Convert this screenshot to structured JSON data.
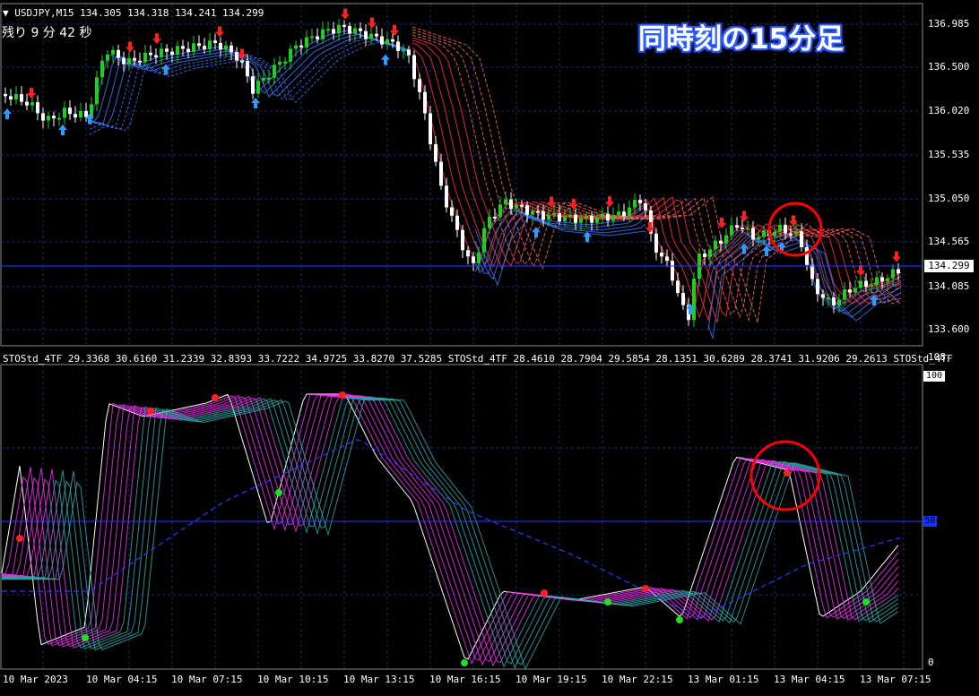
{
  "header": {
    "symbol_label": "▼ USDJPY,M15  134.305 134.318 134.241 134.299",
    "countdown": "残り 9 分 42 秒",
    "overlay_title": "同時刻の15分足"
  },
  "price_axis": {
    "ticks": [
      "136.985",
      "136.500",
      "136.020",
      "135.535",
      "135.050",
      "134.565",
      "134.085",
      "133.600"
    ],
    "current_price": "134.299"
  },
  "indicator": {
    "label": "STOStd_4TF 29.3368 30.6160 31.2339 32.8393 33.7222 34.9725 33.8270 37.5285   STOStd_4TF 28.4610 28.7904 29.5854 28.1351 30.6289 28.3741 31.9206 29.2613   STOStd_4TF",
    "axis_top": "108",
    "axis_100": "100",
    "axis_50": "50",
    "axis_0": "0"
  },
  "time_axis": {
    "labels": [
      "10 Mar 2023",
      "10 Mar 04:15",
      "10 Mar 07:15",
      "10 Mar 10:15",
      "10 Mar 13:15",
      "10 Mar 16:15",
      "10 Mar 19:15",
      "10 Mar 22:15",
      "13 Mar 01:15",
      "13 Mar 04:15",
      "13 Mar 07:15"
    ]
  },
  "colors": {
    "background": "#000000",
    "grid": "#1a2a78",
    "bull_candle": "#22cc22",
    "bear_candle": "#ffffff",
    "ma_red": "#ff3030",
    "ma_blue": "#3a78ff",
    "sto_white": "#ffffff",
    "sto_magenta": "#ff33ff",
    "sto_teal": "#33b0b0",
    "circle": "#ff0000",
    "arrow_up": "#3399ff",
    "arrow_down": "#ff2020"
  }
}
